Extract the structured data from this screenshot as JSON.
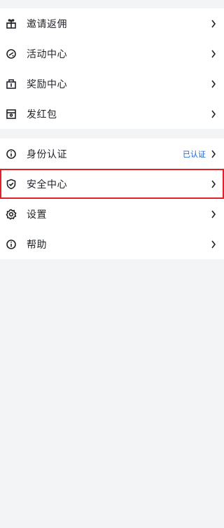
{
  "group1": [
    {
      "label": "邀请返佣",
      "icon": "gift-icon"
    },
    {
      "label": "活动中心",
      "icon": "activity-icon"
    },
    {
      "label": "奖励中心",
      "icon": "reward-icon"
    },
    {
      "label": "发红包",
      "icon": "red-packet-icon"
    }
  ],
  "group2": [
    {
      "label": "身份认证",
      "icon": "info-icon",
      "status": "已认证"
    },
    {
      "label": "安全中心",
      "icon": "shield-icon",
      "highlight_color": "#e0202a"
    },
    {
      "label": "设置",
      "icon": "settings-icon"
    },
    {
      "label": "帮助",
      "icon": "help-icon"
    }
  ],
  "colors": {
    "status": "#1b5fd6",
    "highlight": "#e0202a",
    "background": "#f3f4f6"
  }
}
